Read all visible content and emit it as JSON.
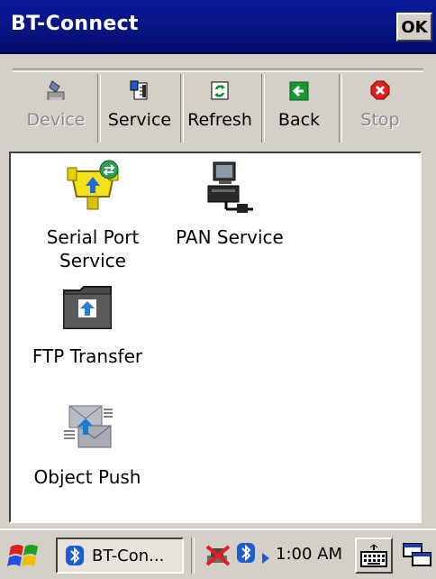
{
  "window": {
    "title": "BT-Connect",
    "ok_label": "OK"
  },
  "toolbar": {
    "buttons": [
      {
        "label": "Device",
        "icon": "device-icon",
        "enabled": false
      },
      {
        "label": "Service",
        "icon": "service-icon",
        "enabled": true
      },
      {
        "label": "Refresh",
        "icon": "refresh-icon",
        "enabled": true
      },
      {
        "label": "Back",
        "icon": "back-arrow-icon",
        "enabled": true
      },
      {
        "label": "Stop",
        "icon": "stop-icon",
        "enabled": false
      }
    ]
  },
  "services": [
    {
      "label": "Serial Port\nService",
      "icon": "serial-port-icon"
    },
    {
      "label": "PAN Service",
      "icon": "pan-network-icon"
    },
    {
      "label": "FTP Transfer",
      "icon": "ftp-folder-icon"
    },
    {
      "label": "Object Push",
      "icon": "object-push-icon"
    }
  ],
  "taskbar": {
    "start_icon": "windows-flag-icon",
    "task_label": "BT-Con...",
    "clock": "1:00 AM",
    "tray_icons": [
      "network-disconnected-icon",
      "bluetooth-icon",
      "tray-arrow-icon"
    ],
    "keyboard_icon": "keyboard-icon",
    "desktop_icon": "desktop-switch-icon"
  },
  "colors": {
    "titlebar": "#06147f",
    "chrome": "#d4d0c8",
    "disabled_text": "#8a8a8a"
  }
}
